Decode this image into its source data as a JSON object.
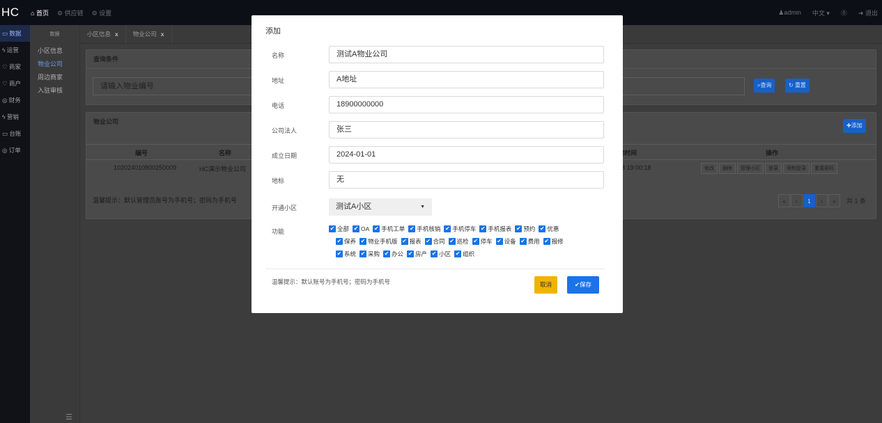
{
  "app": {
    "logo": "HC",
    "nav": [
      {
        "icon": "home-icon",
        "glyph": "⌂",
        "label": "首页"
      },
      {
        "icon": "gear-icon",
        "glyph": "⚙",
        "label": "供应链"
      },
      {
        "icon": "gear-icon",
        "glyph": "⚙",
        "label": "设置"
      }
    ],
    "user": "admin",
    "language": "中文",
    "logout": "退出"
  },
  "sidebar": [
    {
      "label": "数据",
      "glyph": "▭",
      "active": true
    },
    {
      "label": "运营",
      "glyph": "ϟ",
      "active": false
    },
    {
      "label": "商家",
      "glyph": "♡",
      "active": false
    },
    {
      "label": "商户",
      "glyph": "♡",
      "active": false
    },
    {
      "label": "财务",
      "glyph": "◎",
      "active": false
    },
    {
      "label": "营销",
      "glyph": "ϟ",
      "active": false
    },
    {
      "label": "台账",
      "glyph": "▭",
      "active": false
    },
    {
      "label": "订单",
      "glyph": "◎",
      "active": false
    }
  ],
  "submenu": {
    "header": "数据",
    "items": [
      {
        "label": "小区信息",
        "active": false
      },
      {
        "label": "物业公司",
        "active": true
      },
      {
        "label": "周边商家",
        "active": false
      },
      {
        "label": "入驻审核",
        "active": false
      }
    ]
  },
  "tabs": [
    {
      "label": "小区信息",
      "close": "x"
    },
    {
      "label": "物业公司",
      "close": "x"
    }
  ],
  "query": {
    "title": "查询条件",
    "placeholder": "请输入物业编号",
    "search_label": "查询",
    "reset_label": "重置"
  },
  "list": {
    "title": "物业公司",
    "add_label": "添加",
    "columns": {
      "id": "编号",
      "name": "名称",
      "created": "建时间",
      "ops": "操作"
    },
    "rows": [
      {
        "id": "102024010800250009",
        "name": "HC演示物业公司",
        "created": "08 19:00:18",
        "ops": [
          "修改",
          "删除",
          "管理小区",
          "登录",
          "限制登录",
          "重置密码"
        ]
      }
    ],
    "tip": "温馨提示：默认管理员账号为手机号；密码为手机号",
    "pager": {
      "first": "«",
      "prev": "‹",
      "page": "1",
      "next": "›",
      "last": "»",
      "total": "共 1 条"
    }
  },
  "modal": {
    "title": "添加",
    "fields": [
      {
        "label": "名称",
        "value": "测试A物业公司"
      },
      {
        "label": "地址",
        "value": "A地址"
      },
      {
        "label": "电话",
        "value": "18900000000"
      },
      {
        "label": "公司法人",
        "value": "张三"
      },
      {
        "label": "成立日期",
        "value": "2024-01-01"
      },
      {
        "label": "地标",
        "value": "无"
      }
    ],
    "community_label": "开通小区",
    "community_value": "测试A小区",
    "functions_label": "功能",
    "functions": [
      [
        "全部",
        "OA",
        "手机工单",
        "手机核销",
        "手机停车",
        "手机报表",
        "预约",
        "优惠"
      ],
      [
        "保养",
        "物业手机版",
        "报表",
        "合同",
        "巡检",
        "停车",
        "设备",
        "费用",
        "报修"
      ],
      [
        "系统",
        "采购",
        "办公",
        "房产",
        "小区",
        "组织"
      ]
    ],
    "tip": "温馨提示：默认账号为手机号；密码为手机号",
    "cancel_label": "取消",
    "save_label": "保存"
  }
}
